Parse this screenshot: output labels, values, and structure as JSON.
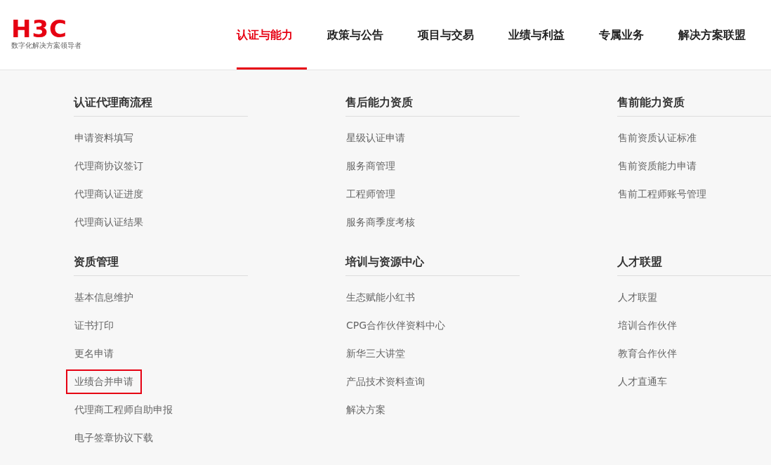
{
  "logo": {
    "wordmark": "H3C",
    "tagline": "数字化解决方案领导者"
  },
  "nav": [
    {
      "label": "认证与能力",
      "selected": true
    },
    {
      "label": "政策与公告",
      "selected": false
    },
    {
      "label": "项目与交易",
      "selected": false
    },
    {
      "label": "业绩与利益",
      "selected": false
    },
    {
      "label": "专属业务",
      "selected": false
    },
    {
      "label": "解决方案联盟",
      "selected": false
    }
  ],
  "columns": [
    {
      "sections": [
        {
          "title": "认证代理商流程",
          "items": [
            {
              "label": "申请资料填写",
              "outlined": false
            },
            {
              "label": "代理商协议签订",
              "outlined": false
            },
            {
              "label": "代理商认证进度",
              "outlined": false
            },
            {
              "label": "代理商认证结果",
              "outlined": false
            }
          ]
        },
        {
          "title": "资质管理",
          "items": [
            {
              "label": "基本信息维护",
              "outlined": false
            },
            {
              "label": "证书打印",
              "outlined": false
            },
            {
              "label": "更名申请",
              "outlined": false
            },
            {
              "label": "业绩合并申请",
              "outlined": true
            },
            {
              "label": "代理商工程师自助申报",
              "outlined": false
            },
            {
              "label": "电子签章协议下载",
              "outlined": false
            }
          ]
        }
      ]
    },
    {
      "sections": [
        {
          "title": "售后能力资质",
          "items": [
            {
              "label": "星级认证申请",
              "outlined": false
            },
            {
              "label": "服务商管理",
              "outlined": false
            },
            {
              "label": "工程师管理",
              "outlined": false
            },
            {
              "label": "服务商季度考核",
              "outlined": false
            }
          ]
        },
        {
          "title": "培训与资源中心",
          "items": [
            {
              "label": "生态赋能小红书",
              "outlined": false
            },
            {
              "label": "CPG合作伙伴资料中心",
              "outlined": false
            },
            {
              "label": "新华三大讲堂",
              "outlined": false
            },
            {
              "label": "产品技术资料查询",
              "outlined": false
            },
            {
              "label": "解决方案",
              "outlined": false
            }
          ]
        }
      ]
    },
    {
      "sections": [
        {
          "title": "售前能力资质",
          "items": [
            {
              "label": "售前资质认证标准",
              "outlined": false
            },
            {
              "label": "售前资质能力申请",
              "outlined": false
            },
            {
              "label": "售前工程师账号管理",
              "outlined": false
            }
          ]
        },
        {
          "title": "人才联盟",
          "items": [
            {
              "label": "人才联盟",
              "outlined": false
            },
            {
              "label": "培训合作伙伴",
              "outlined": false
            },
            {
              "label": "教育合作伙伴",
              "outlined": false
            },
            {
              "label": "人才直通车",
              "outlined": false
            }
          ]
        }
      ]
    }
  ]
}
